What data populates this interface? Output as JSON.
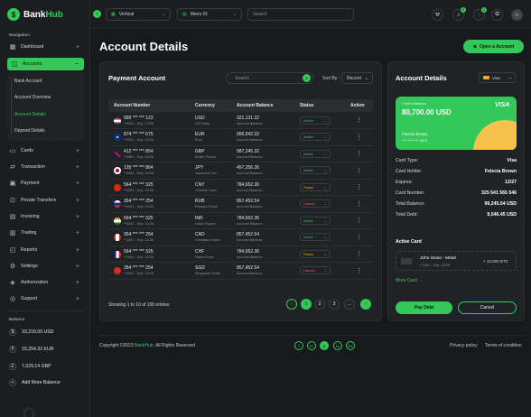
{
  "brand": {
    "name_a": "Bank",
    "name_b": "Hub"
  },
  "sidebar": {
    "nav_heading": "Navigation",
    "items": [
      {
        "label": "Dashboard",
        "icon": "grid-icon"
      },
      {
        "label": "Accounts",
        "icon": "wallet-icon"
      },
      {
        "label": "Cards",
        "icon": "card-icon"
      },
      {
        "label": "Transaction",
        "icon": "transfer-icon"
      },
      {
        "label": "Payment",
        "icon": "payment-icon"
      },
      {
        "label": "Private Transfers",
        "icon": "lock-icon"
      },
      {
        "label": "Invoicing",
        "icon": "document-icon"
      },
      {
        "label": "Trading",
        "icon": "chart-icon"
      },
      {
        "label": "Reports",
        "icon": "report-icon"
      },
      {
        "label": "Settings",
        "icon": "gear-icon"
      },
      {
        "label": "Authorization",
        "icon": "shield-icon"
      },
      {
        "label": "Support",
        "icon": "help-icon"
      }
    ],
    "sub_items": [
      "Bank Account",
      "Account Overview",
      "Account Details",
      "Deposit Details"
    ],
    "balance_heading": "Balance",
    "balances": [
      {
        "label": "33,215.00 USD",
        "symbol": "$"
      },
      {
        "label": "15,254.32 EUR",
        "symbol": "€"
      },
      {
        "label": "7,029.14 GBP",
        "symbol": "£"
      }
    ],
    "add_balance": "Add More Balance"
  },
  "topbar": {
    "selector1": "Vertical",
    "selector2": "Menu 01",
    "search_placeholder": "Search",
    "notif_count": "8",
    "msg_count": "3"
  },
  "page": {
    "title": "Account Details",
    "open_account": "Open a Account"
  },
  "payment": {
    "title": "Payment Account",
    "search_placeholder": "Search",
    "sort_label": "Sort By :",
    "sort_value": "Recent",
    "columns": [
      "Account Number",
      "Currency",
      "Account Balance",
      "Status",
      "Action"
    ],
    "rows": [
      {
        "number": "999 *** *** 123",
        "expiry": "**4281 - Exp: 12/26",
        "currency": "USD",
        "cur_name": "US Dollar",
        "balance": "321,131.32",
        "bal_label": "Account Balance",
        "status": "Active",
        "flag": "us"
      },
      {
        "number": "874 *** *** 675",
        "expiry": "**4281 - Exp: 12/26",
        "currency": "EUR",
        "cur_name": "Euro",
        "balance": "956,542.32",
        "bal_label": "Account Balance",
        "status": "Active",
        "flag": "eu"
      },
      {
        "number": "412 *** *** 854",
        "expiry": "**4281 - Exp: 12/26",
        "currency": "GBP",
        "cur_name": "British Pound",
        "balance": "987,245.32",
        "bal_label": "Account Balance",
        "status": "Active",
        "flag": "gb"
      },
      {
        "number": "135 *** *** 864",
        "expiry": "**4281 - Exp: 12/26",
        "currency": "JPY",
        "cur_name": "Japanese Yen",
        "balance": "457,256.36",
        "bal_label": "Account Balance",
        "status": "Active",
        "flag": "jp"
      },
      {
        "number": "564 *** *** 325",
        "expiry": "**4281 - Exp: 12/26",
        "currency": "CNY",
        "cur_name": "Chinese Yuan",
        "balance": "784,652.36",
        "bal_label": "Account Balance",
        "status": "Pause",
        "flag": "cn"
      },
      {
        "number": "354 *** *** 254",
        "expiry": "**4281 - Exp: 12/26",
        "currency": "RUB",
        "cur_name": "Russian Ruble",
        "balance": "857,452.54",
        "bal_label": "Account Balance",
        "status": "Cancel",
        "flag": "ru"
      },
      {
        "number": "564 *** *** 325",
        "expiry": "**4281 - Exp: 12/26",
        "currency": "INR",
        "cur_name": "Indian Rupee",
        "balance": "784,652.36",
        "bal_label": "Account Balance",
        "status": "Active",
        "flag": "in"
      },
      {
        "number": "354 *** *** 254",
        "expiry": "**4281 - Exp: 12/26",
        "currency": "CAD",
        "cur_name": "Canadian Dollar",
        "balance": "857,452.54",
        "bal_label": "Account Balance",
        "status": "Active",
        "flag": "ca"
      },
      {
        "number": "564 *** *** 325",
        "expiry": "**4281 - Exp: 12/26",
        "currency": "CHF",
        "cur_name": "Swiss Franc",
        "balance": "784,652.36",
        "bal_label": "Account Balance",
        "status": "Pause",
        "flag": "fr"
      },
      {
        "number": "354 *** *** 254",
        "expiry": "**4281 - Exp: 12/26",
        "currency": "SGD",
        "cur_name": "Singapore Dollar",
        "balance": "857,452.54",
        "bal_label": "Account Balance",
        "status": "Cancel",
        "flag": "ch"
      }
    ],
    "entries": "Showing 1 to 10 of 100 entries",
    "pages": [
      "1",
      "2",
      "3",
      "..."
    ]
  },
  "details": {
    "title": "Account Details",
    "card_brand_select": "Visa",
    "card": {
      "balance_label": "Current Balance",
      "balance": "80,700.00 USD",
      "brand": "VISA",
      "holder": "Felecia Brown",
      "mask": "**** **** **** 8875"
    },
    "fields": [
      {
        "k": "Card Type:",
        "v": "Visa"
      },
      {
        "k": "Card Holder:",
        "v": "Felecia Brown"
      },
      {
        "k": "Expires:",
        "v": "12/27"
      },
      {
        "k": "Card Number:",
        "v": "325 541 565 546"
      },
      {
        "k": "Total Balance:",
        "v": "99,245.54 USD"
      },
      {
        "k": "Total Debt:",
        "v": "9,546.45 USD"
      }
    ],
    "active_card_label": "Active Card",
    "active_card_name": "John Snow - Metal",
    "active_card_sub": "**4281 - Exp: 12/26",
    "active_card_amount": "+ 10,000 BTC",
    "more_card": "More Card",
    "pay_debt": "Pay Debt",
    "cancel": "Cancel"
  },
  "footer": {
    "copy_a": "Copyright ©2023",
    "copy_brand": "BankHub",
    "copy_b": ". All Rights Reserved",
    "privacy": "Privacy policy",
    "terms": "Terms of condition",
    "social": [
      "f",
      "in",
      "p",
      "ig",
      "be"
    ]
  },
  "colors": {
    "accent": "#34c759",
    "pause": "#f5a623",
    "cancel": "#ff5a5a"
  }
}
